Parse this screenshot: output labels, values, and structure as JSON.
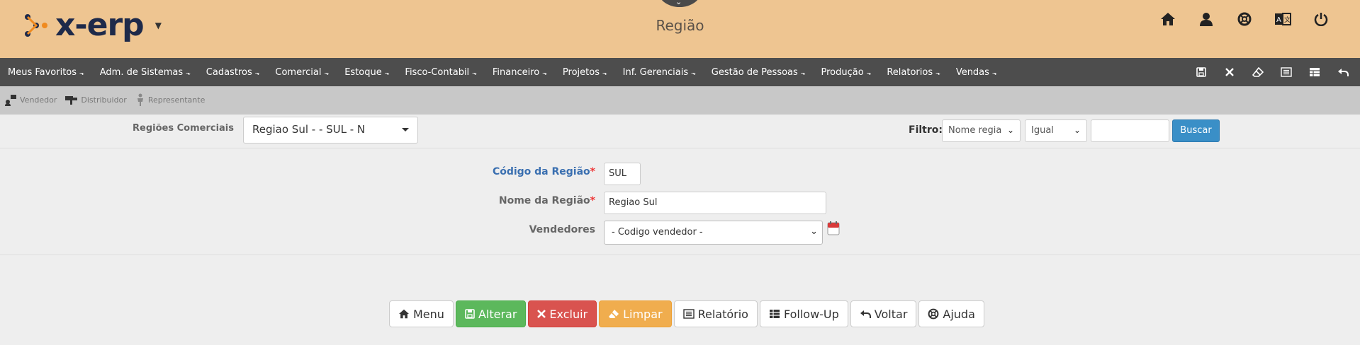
{
  "header": {
    "logo_text": "x-erp",
    "title": "Região",
    "icons": [
      "home-icon",
      "user-icon",
      "lifebuoy-icon",
      "translate-icon",
      "power-icon"
    ]
  },
  "menu": {
    "items": [
      "Meus Favoritos",
      "Adm. de Sistemas",
      "Cadastros",
      "Comercial",
      "Estoque",
      "Fisco-Contabil",
      "Financeiro",
      "Projetos",
      "Inf. Gerenciais",
      "Gestão de Pessoas",
      "Produção",
      "Relatorios",
      "Vendas"
    ],
    "caret": "⬎",
    "toolbar_icons": [
      "save-icon",
      "close-icon",
      "eraser-icon",
      "list-icon",
      "table-icon",
      "undo-icon"
    ]
  },
  "subbar": {
    "items": [
      "Vendedor",
      "Distribuidor",
      "Representante"
    ]
  },
  "filter": {
    "regioes_label": "Regiões Comerciais",
    "regioes_value": "Regiao Sul - - SUL - N",
    "filtro_label": "Filtro:",
    "field_value": "Nome regia",
    "op_value": "Igual",
    "search_value": "",
    "buscar_label": "Buscar"
  },
  "form": {
    "codigo_label": "Código da Região",
    "codigo_value": "SUL",
    "nome_label": "Nome da Região",
    "nome_value": "Regiao Sul",
    "vendedores_label": "Vendedores",
    "vendedores_value": "- Codigo vendedor -",
    "required_mark": "*"
  },
  "buttons": {
    "menu": "Menu",
    "alterar": "Alterar",
    "excluir": "Excluir",
    "limpar": "Limpar",
    "relatorio": "Relatório",
    "followup": "Follow-Up",
    "voltar": "Voltar",
    "ajuda": "Ajuda"
  },
  "colors": {
    "header_bg": "#eec591",
    "menubar_bg": "#4d4d4d",
    "subbar_bg": "#c8c8c8",
    "accent_blue": "#3a8fc7",
    "green": "#5cb85c",
    "red": "#d9534f",
    "orange": "#f0ad4e"
  }
}
